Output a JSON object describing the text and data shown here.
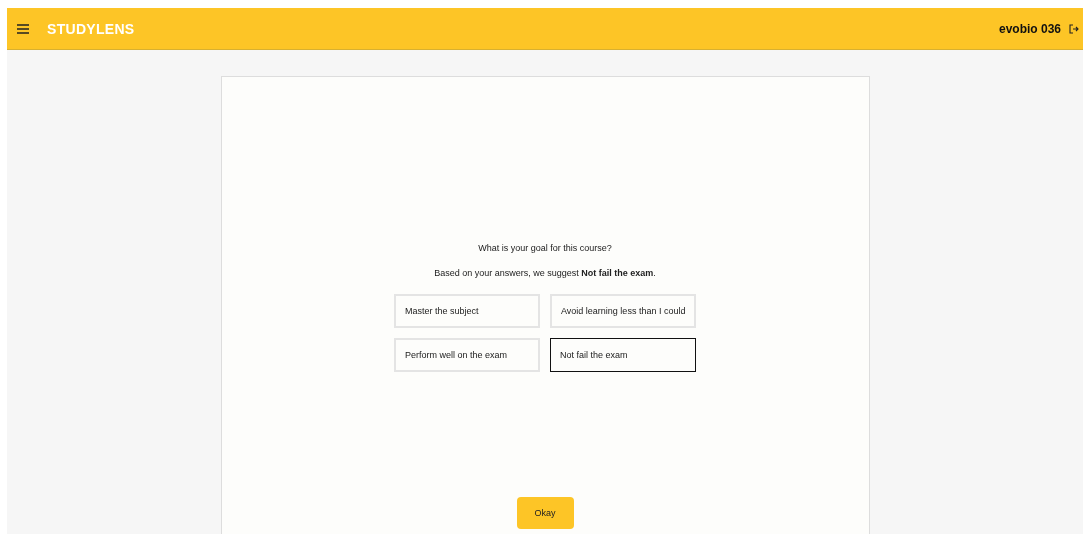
{
  "header": {
    "brand": "STUDYLENS",
    "username": "evobio 036"
  },
  "question": "What is your goal for this course?",
  "suggestion": "Based on your answers, we suggest **Not fail the exam**.",
  "options": [
    {
      "label": "Master the subject",
      "selected": false
    },
    {
      "label": "Avoid learning less than I could",
      "selected": false
    },
    {
      "label": "Perform well on the exam",
      "selected": false
    },
    {
      "label": "Not fail the exam",
      "selected": true
    }
  ],
  "confirm_button": "Okay"
}
